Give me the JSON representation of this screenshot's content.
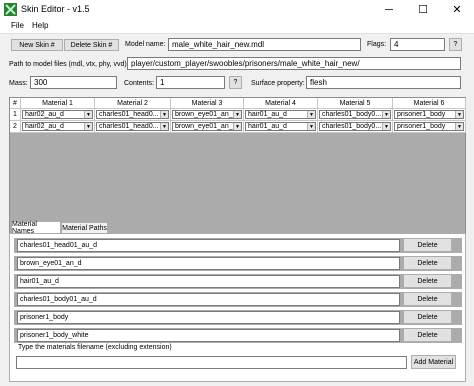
{
  "window": {
    "title": "Skin Editor - v1.5",
    "icon": "green-x-icon",
    "minimize": "─",
    "maximize": "☐",
    "close": "✕"
  },
  "menu": {
    "items": [
      "File",
      "Help"
    ]
  },
  "toolbar": {
    "new_skin": "New Skin #",
    "delete_skin": "Delete Skin #",
    "model_name_label": "Model name:",
    "model_name_value": "male_white_hair_new.mdl",
    "flags_label": "Flags:",
    "flags_value": "4",
    "flags_help": "?",
    "path_label": "Path to model files (mdl, vtx, phy, vvd):",
    "path_value": "player/custom_player/swoobles/prisoners/male_white_hair_new/",
    "mass_label": "Mass:",
    "mass_value": "300",
    "contents_label": "Contents:",
    "contents_value": "1",
    "contents_help": "?",
    "surface_label": "Surface property:",
    "surface_value": "flesh"
  },
  "grid": {
    "corner": "#",
    "columns": [
      "Material 1",
      "Material 2",
      "Material 3",
      "Material 4",
      "Material 5",
      "Material 6"
    ],
    "rows": [
      {
        "index": "1",
        "cells": [
          "hair02_au_d",
          "charles01_head0...",
          "brown_eye01_an_d",
          "hair01_au_d",
          "charles01_body0...",
          "prisoner1_body"
        ]
      },
      {
        "index": "2",
        "cells": [
          "hair02_au_d",
          "charles01_head0...",
          "brown_eye01_an_d",
          "hair01_au_d",
          "charles01_body0...",
          "prisoner1_body"
        ]
      }
    ],
    "dropdown_arrow": "▼"
  },
  "tabs": [
    "Material Names",
    "Material Paths"
  ],
  "materials": {
    "items": [
      "charles01_head01_au_d",
      "brown_eye01_an_d",
      "hair01_au_d",
      "charles01_body01_au_d",
      "prisoner1_body",
      "prisoner1_body_white"
    ],
    "delete_label": "Delete"
  },
  "add_material": {
    "group_label": "Type the materials filename (excluding extension)",
    "input_value": "",
    "button_label": "Add Material"
  }
}
